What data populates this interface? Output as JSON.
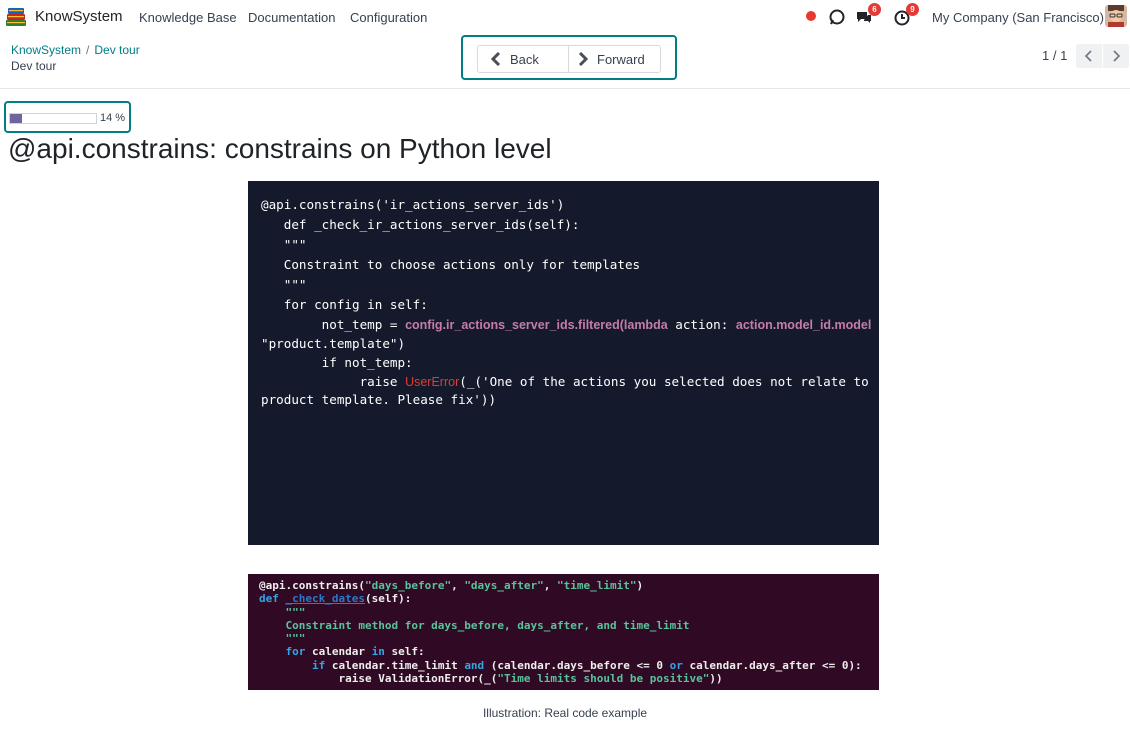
{
  "navbar": {
    "brand": "KnowSystem",
    "menu": [
      "Knowledge Base",
      "Documentation",
      "Configuration"
    ],
    "messages_count": "6",
    "activities_count": "9",
    "company": "My Company (San Francisco)"
  },
  "breadcrumb": {
    "root": "KnowSystem",
    "separator": "/",
    "current": "Dev tour",
    "subtitle": "Dev tour"
  },
  "nav": {
    "back_label": "Back",
    "forward_label": "Forward"
  },
  "pager": {
    "value": "1 / 1"
  },
  "progress": {
    "percent": 14,
    "label": "14 %"
  },
  "slide": {
    "title": "@api.constrains: constrains on Python level"
  },
  "code_block_1": {
    "l1": "@api.constrains('ir_actions_server_ids')",
    "l2": "   def _check_ir_actions_server_ids(self):",
    "l3": "   \"\"\"",
    "l4": "   Constraint to choose actions only for templates",
    "l5": "   \"\"\"",
    "l6": "   for config in self:",
    "l7a": "        not_temp = ",
    "l7b": "config.ir_actions_server_ids.filtered(lambda",
    "l7c": " action: ",
    "l7d": "action.model_id.model",
    "l7e": " !=",
    "l8": "\"product.template\")",
    "l9": "        if not_temp:",
    "l10a": "             raise ",
    "l10b": "UserError",
    "l10c": "(_('One of the actions you selected does not relate to",
    "l11": "product template. Please fix'))"
  },
  "code_block_2": {
    "l1a": "@api.constrains(",
    "l1b": "\"days_before\"",
    "l1c": ", ",
    "l1d": "\"days_after\"",
    "l1e": ", ",
    "l1f": "\"time_limit\"",
    "l1g": ")",
    "l2a": "def",
    "l2b": " ",
    "l2c": "_check_dates",
    "l2d": "(self):",
    "l3": "    \"\"\"",
    "l4": "    Constraint method for days_before, days_after, and time_limit",
    "l5": "    \"\"\"",
    "l6a": "    ",
    "l6b": "for",
    "l6c": " calendar ",
    "l6d": "in",
    "l6e": " self:",
    "l7a": "        ",
    "l7b": "if",
    "l7c": " calendar.time_limit ",
    "l7d": "and",
    "l7e": " (calendar.days_before <= 0 ",
    "l7f": "or",
    "l7g": " calendar.days_after <= 0):",
    "l8a": "            raise ValidationError(_(",
    "l8b": "\"Time limits should be positive\"",
    "l8c": "))"
  },
  "caption": "Illustration: Real code example"
}
